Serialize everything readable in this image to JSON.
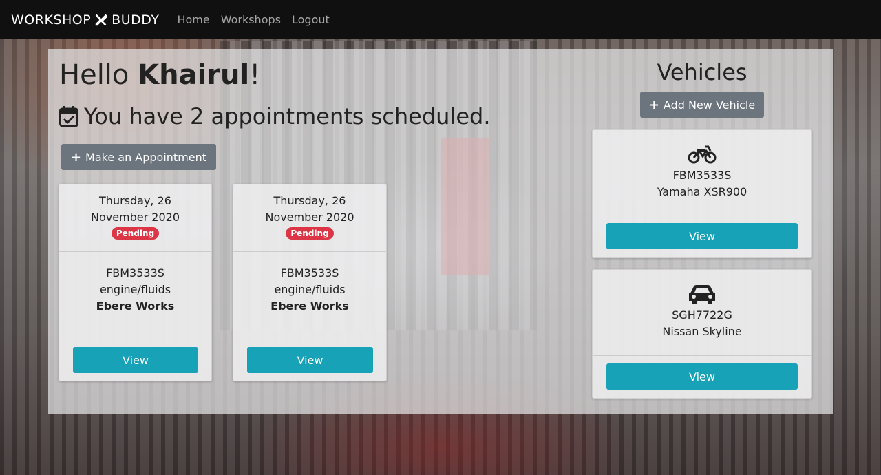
{
  "navbar": {
    "brand_left": "WORKSHOP",
    "brand_right": "BUDDY",
    "brand_icon": "tools-icon",
    "links": [
      "Home",
      "Workshops",
      "Logout"
    ]
  },
  "greeting": {
    "prefix": "Hello ",
    "name": "Khairul",
    "suffix": "!",
    "appointments_text": "You have 2 appointments scheduled.",
    "make_appointment": "Make an Appointment"
  },
  "appointments": [
    {
      "date_line1": "Thursday, 26",
      "date_line2": "November 2020",
      "status": "Pending",
      "plate": "FBM3533S",
      "service": "engine/fluids",
      "workshop": "Ebere Works",
      "view": "View"
    },
    {
      "date_line1": "Thursday, 26",
      "date_line2": "November 2020",
      "status": "Pending",
      "plate": "FBM3533S",
      "service": "engine/fluids",
      "workshop": "Ebere Works",
      "view": "View"
    }
  ],
  "vehicles": {
    "title": "Vehicles",
    "add_new": "Add New Vehicle",
    "items": [
      {
        "icon": "motorcycle-icon",
        "plate": "FBM3533S",
        "model": "Yamaha XSR900",
        "view": "View"
      },
      {
        "icon": "car-icon",
        "plate": "SGH7722G",
        "model": "Nissan Skyline",
        "view": "View"
      }
    ]
  },
  "colors": {
    "navbar": "#101010",
    "secondary_button": "#6c757d",
    "info_button": "#17a2b8",
    "badge_danger": "#dc3545"
  }
}
